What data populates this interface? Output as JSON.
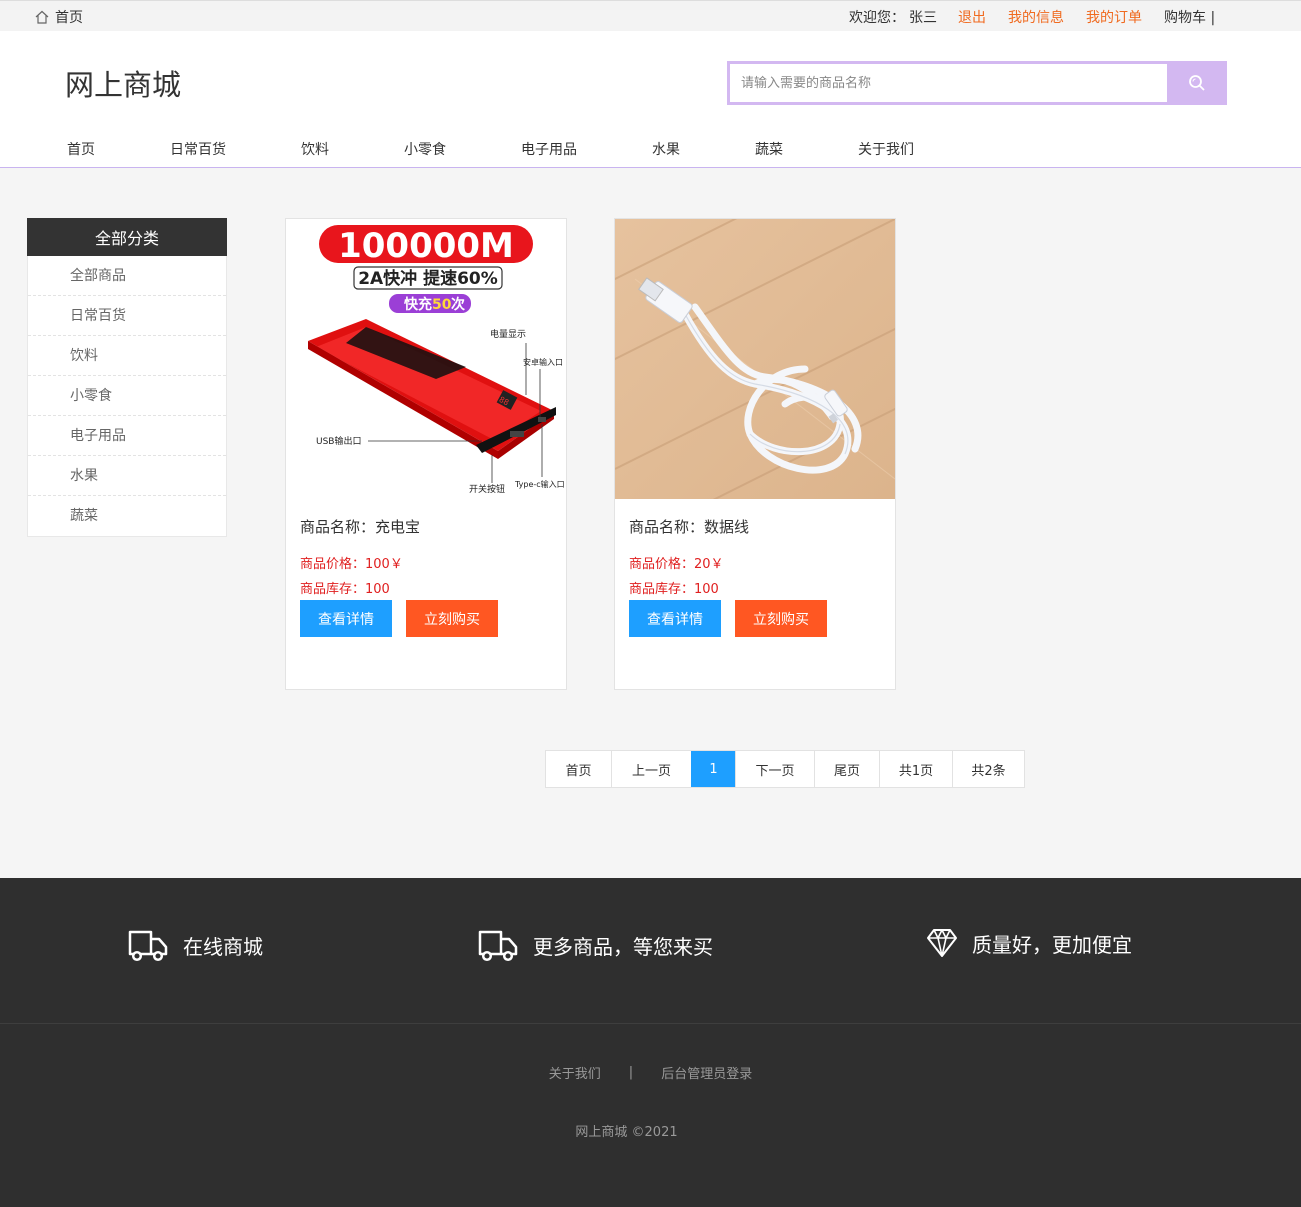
{
  "topbar": {
    "home_label": "首页",
    "welcome": "欢迎您：",
    "username": "张三",
    "logout": "退出",
    "my_info": "我的信息",
    "my_orders": "我的订单",
    "cart": "购物车 |"
  },
  "header": {
    "logo": "网上商城",
    "search_placeholder": "请输入需要的商品名称"
  },
  "nav": [
    "首页",
    "日常百货",
    "饮料",
    "小零食",
    "电子用品",
    "水果",
    "蔬菜",
    "关于我们"
  ],
  "sidebar": {
    "title": "全部分类",
    "items": [
      "全部商品",
      "日常百货",
      "饮料",
      "小零食",
      "电子用品",
      "水果",
      "蔬菜"
    ]
  },
  "products": [
    {
      "name": "商品名称：充电宝",
      "price": "商品价格：100￥",
      "stock": "商品库存：100",
      "detail_label": "查看详情",
      "buy_label": "立刻购买",
      "image_text": {
        "capacity": "100000M",
        "fast": "2A快冲 提速60%",
        "charge_prefix": "快充",
        "charge_num": "50",
        "charge_suffix": "次",
        "battery": "电量显示",
        "android": "安卓输入口",
        "usb": "USB输出口",
        "switch": "开关按钮",
        "typec": "Type-c输入口"
      }
    },
    {
      "name": "商品名称：数据线",
      "price": "商品价格：20￥",
      "stock": "商品库存：100",
      "detail_label": "查看详情",
      "buy_label": "立刻购买"
    }
  ],
  "pager": {
    "first": "首页",
    "prev": "上一页",
    "current": "1",
    "next": "下一页",
    "last": "尾页",
    "total_pages": "共1页",
    "total_items": "共2条"
  },
  "footer": {
    "feature1": "在线商城",
    "feature2": "更多商品，等您来买",
    "feature3": "质量好，更加便宜",
    "about": "关于我们",
    "sep": "|",
    "admin": "后台管理员登录",
    "copyright": "网上商城 ©2021"
  },
  "colors": {
    "accent_purple": "#d3b8f1",
    "blue_button": "#1e9fff",
    "orange_button": "#ff5722",
    "price_red": "#e02020",
    "link_orange": "#f06a1f",
    "footer_bg": "#2f2f2f"
  }
}
